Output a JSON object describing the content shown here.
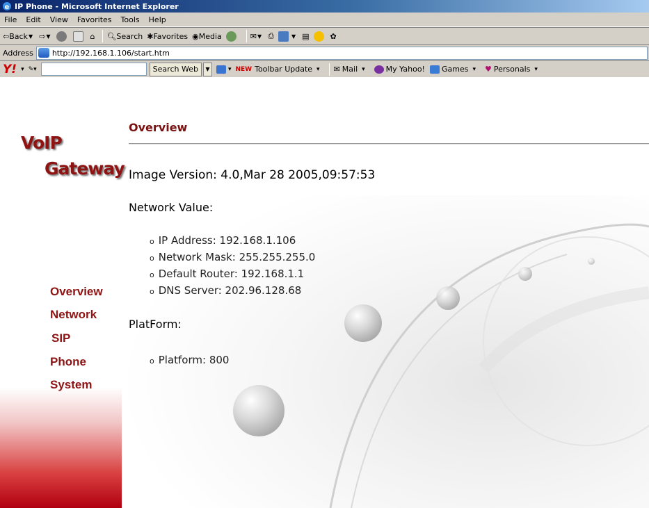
{
  "window": {
    "title": "IP Phone - Microsoft Internet Explorer"
  },
  "menu": [
    "File",
    "Edit",
    "View",
    "Favorites",
    "Tools",
    "Help"
  ],
  "nav_toolbar": {
    "back": "Back",
    "search": "Search",
    "favorites": "Favorites",
    "media": "Media"
  },
  "address": {
    "label": "Address",
    "url": "http://192.168.1.106/start.htm"
  },
  "yahoo_toolbar": {
    "search_button": "Search Web",
    "new_badge": "NEW",
    "toolbar_update": "Toolbar Update",
    "mail": "Mail",
    "my_yahoo": "My Yahoo!",
    "games": "Games",
    "personals": "Personals"
  },
  "sidebar": {
    "brand_line1": "VoIP",
    "brand_line2": "Gateway",
    "links": [
      "Overview",
      "Network",
      "SIP",
      "Phone",
      "System"
    ]
  },
  "main": {
    "title": "Overview",
    "image_version": "Image Version: 4.0,Mar 28 2005,09:57:53",
    "network_heading": "Network Value:",
    "network_items": [
      "IP Address: 192.168.1.106",
      "Network Mask: 255.255.255.0",
      "Default Router: 192.168.1.1",
      "DNS Server: 202.96.128.68"
    ],
    "platform_heading": "PlatForm:",
    "platform_items": [
      "Platform: 800"
    ]
  },
  "colors": {
    "brand": "#8e1313",
    "title_bar": "#0a246a",
    "chrome": "#d4d0c8",
    "sidebar_gradient_end": "#b00010"
  }
}
